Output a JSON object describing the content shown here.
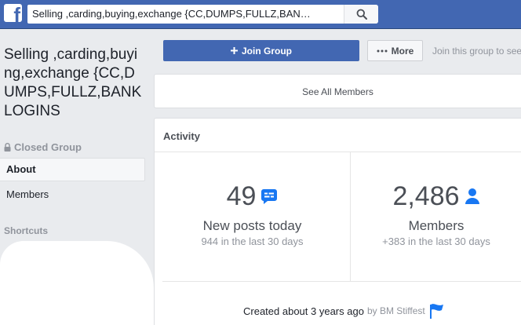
{
  "search": {
    "value": "Selling ,carding,buying,exchange {CC,DUMPS,FULLZ,BAN…",
    "icon": "search-icon"
  },
  "logo": {
    "glyph": "f",
    "icon": "facebook-logo-icon"
  },
  "group": {
    "name": "Selling ,carding,buying,exchange {CC,DUMPS,FULLZ,BANK LOGINS",
    "privacy": "Closed Group"
  },
  "sidebar": {
    "items": [
      {
        "label": "About",
        "active": true
      },
      {
        "label": "Members",
        "active": false
      }
    ],
    "shortcuts_label": "Shortcuts"
  },
  "actions": {
    "join_label": "Join Group",
    "more_label": "More",
    "hint": "Join this group to see"
  },
  "members_card": {
    "see_all_label": "See All Members"
  },
  "activity": {
    "title": "Activity",
    "posts": {
      "number": "49",
      "label": "New posts today",
      "sub": "944 in the last 30 days"
    },
    "members": {
      "number": "2,486",
      "label": "Members",
      "sub": "+383 in the last 30 days"
    }
  },
  "created": {
    "text": "Created about 3 years ago",
    "by": "by BM Stiffest"
  },
  "colors": {
    "brand": "#4267b2",
    "accent": "#1877f2"
  }
}
